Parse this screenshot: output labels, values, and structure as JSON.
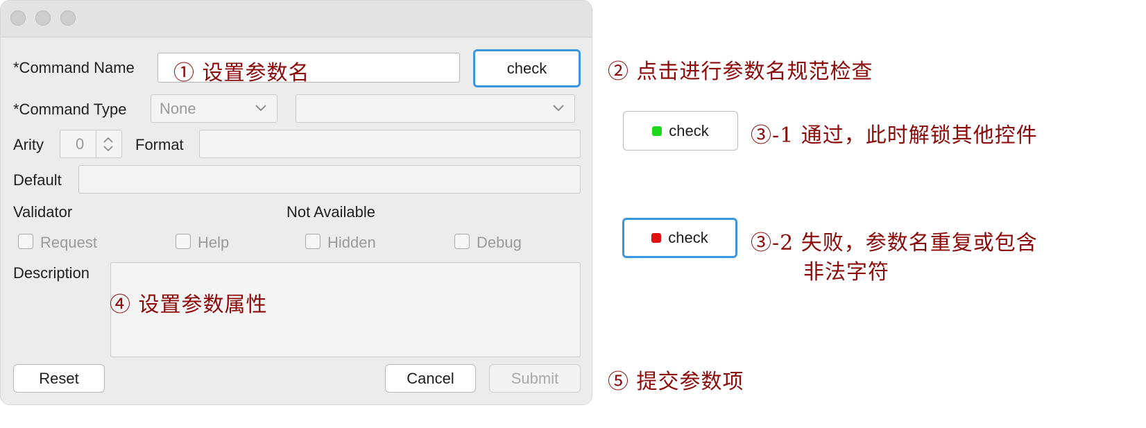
{
  "form": {
    "command_name_label": "*Command Name",
    "command_name_hint": "① 设置参数名",
    "check_label": "check",
    "command_type_label": "*Command Type",
    "command_type_value": "None",
    "arity_label": "Arity",
    "arity_value": "0",
    "format_label": "Format",
    "default_label": "Default",
    "validator_label": "Validator",
    "not_available_label": "Not Available",
    "checkboxes": [
      "Request",
      "Help",
      "Hidden",
      "Debug"
    ],
    "description_label": "Description",
    "description_hint": "④ 设置参数属性",
    "reset_label": "Reset",
    "cancel_label": "Cancel",
    "submit_label": "Submit"
  },
  "annotations": {
    "step2": "② 点击进行参数名规范检查",
    "step3_1": "③-1 通过，此时解锁其他控件",
    "step3_2_line1": "③-2 失败，参数名重复或包含",
    "step3_2_line2": "非法字符",
    "step5": "⑤ 提交参数项"
  },
  "examples": {
    "pass_label": "check",
    "fail_label": "check",
    "pass_color": "#1ed81e",
    "fail_color": "#e01010"
  },
  "colors": {
    "annotation": "#8b0a0a",
    "focus_border": "#3d95e0"
  }
}
